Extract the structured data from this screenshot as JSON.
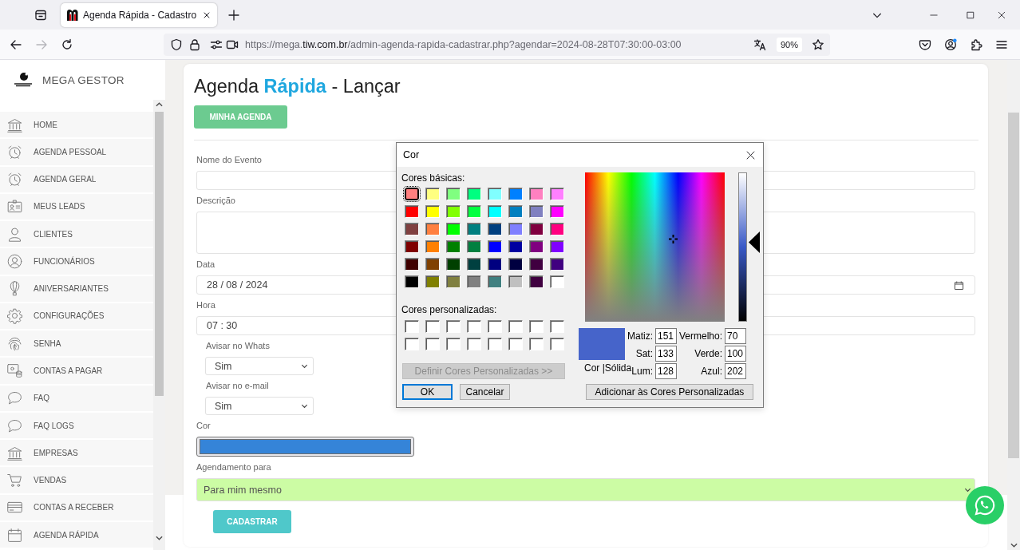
{
  "browser": {
    "tabs": [
      {
        "title": "Agenda Rápida - Cadastro",
        "selected": true
      }
    ],
    "nav_buttons": [
      {
        "kind": "back",
        "disabled": false
      },
      {
        "kind": "forward",
        "disabled": true
      },
      {
        "kind": "reload",
        "disabled": false
      }
    ],
    "url": {
      "prefix": "https://mega.",
      "domain": "tiw.com.br",
      "path": "/admin-agenda-rapida-cadastrar.php?agendar=2024-08-28T07:30:00-03:00"
    },
    "zoom": "90%"
  },
  "sidebar": {
    "brand": "MEGA GESTOR",
    "items": [
      {
        "label": "HOME",
        "kind": "bank"
      },
      {
        "label": "AGENDA PESSOAL",
        "kind": "alarm"
      },
      {
        "label": "AGENDA GERAL",
        "kind": "alarm"
      },
      {
        "label": "MEUS LEADS",
        "kind": "badge"
      },
      {
        "label": "CLIENTES",
        "kind": "user"
      },
      {
        "label": "FUNCIONÁRIOS",
        "kind": "usercircle"
      },
      {
        "label": "ANIVERSARIANTES",
        "kind": "balloon"
      },
      {
        "label": "CONFIGURAÇÕES",
        "kind": "gear"
      },
      {
        "label": "SENHA",
        "kind": "fingerprint"
      },
      {
        "label": "CONTAS A PAGAR",
        "kind": "bills"
      },
      {
        "label": "FAQ",
        "kind": "chat"
      },
      {
        "label": "FAQ LOGS",
        "kind": "chat"
      },
      {
        "label": "EMPRESAS",
        "kind": "bank"
      },
      {
        "label": "VENDAS",
        "kind": "cart"
      },
      {
        "label": "CONTAS A RECEBER",
        "kind": "card"
      },
      {
        "label": "AGENDA RÁPIDA",
        "kind": "calendar"
      }
    ]
  },
  "page": {
    "title": "Agenda **Rápida** - Lançar",
    "agenda_button": "MINHA AGENDA",
    "fields": [
      {
        "kind": "text",
        "label": "Nome do Evento"
      },
      {
        "kind": "textarea",
        "label": "Descrição"
      },
      {
        "kind": "date",
        "label": "Data",
        "value": "28 / 08 / 2024"
      },
      {
        "kind": "time",
        "label": "Hora",
        "value": "07 : 30"
      },
      {
        "kind": "short-select",
        "label": "Avisar no Whats",
        "value": "Sim"
      },
      {
        "kind": "short-select",
        "label": "Avisar no e-mail",
        "value": "Sim"
      },
      {
        "kind": "color",
        "label": "Cor",
        "color": "#3584d8"
      },
      {
        "kind": "wide-select",
        "label": "Agendamento para",
        "value": "Para mim mesmo"
      }
    ],
    "submit_button": "CADASTRAR"
  },
  "color_dialog": {
    "title": "Cor",
    "basic_label": "Cores básicas:",
    "basic_colors": [
      {
        "color": "#ff8080",
        "selected": true
      },
      {
        "color": "#ffff80",
        "selected": false
      },
      {
        "color": "#80ff80",
        "selected": false
      },
      {
        "color": "#00ff80",
        "selected": false
      },
      {
        "color": "#80ffff",
        "selected": false
      },
      {
        "color": "#0080ff",
        "selected": false
      },
      {
        "color": "#ff80c0",
        "selected": false
      },
      {
        "color": "#ff80ff",
        "selected": false
      },
      {
        "color": "#ff0000",
        "selected": false
      },
      {
        "color": "#ffff00",
        "selected": false
      },
      {
        "color": "#80ff00",
        "selected": false
      },
      {
        "color": "#00ff40",
        "selected": false
      },
      {
        "color": "#00ffff",
        "selected": false
      },
      {
        "color": "#0080c0",
        "selected": false
      },
      {
        "color": "#8080c0",
        "selected": false
      },
      {
        "color": "#ff00ff",
        "selected": false
      },
      {
        "color": "#804040",
        "selected": false
      },
      {
        "color": "#ff8040",
        "selected": false
      },
      {
        "color": "#00ff00",
        "selected": false
      },
      {
        "color": "#008080",
        "selected": false
      },
      {
        "color": "#004080",
        "selected": false
      },
      {
        "color": "#8080ff",
        "selected": false
      },
      {
        "color": "#800040",
        "selected": false
      },
      {
        "color": "#ff0080",
        "selected": false
      },
      {
        "color": "#800000",
        "selected": false
      },
      {
        "color": "#ff8000",
        "selected": false
      },
      {
        "color": "#008000",
        "selected": false
      },
      {
        "color": "#008040",
        "selected": false
      },
      {
        "color": "#0000ff",
        "selected": false
      },
      {
        "color": "#0000a0",
        "selected": false
      },
      {
        "color": "#800080",
        "selected": false
      },
      {
        "color": "#8000ff",
        "selected": false
      },
      {
        "color": "#400000",
        "selected": false
      },
      {
        "color": "#804000",
        "selected": false
      },
      {
        "color": "#004000",
        "selected": false
      },
      {
        "color": "#004040",
        "selected": false
      },
      {
        "color": "#000080",
        "selected": false
      },
      {
        "color": "#000040",
        "selected": false
      },
      {
        "color": "#400040",
        "selected": false
      },
      {
        "color": "#400080",
        "selected": false
      },
      {
        "color": "#000000",
        "selected": false
      },
      {
        "color": "#808000",
        "selected": false
      },
      {
        "color": "#808040",
        "selected": false
      },
      {
        "color": "#808080",
        "selected": false
      },
      {
        "color": "#408080",
        "selected": false
      },
      {
        "color": "#c0c0c0",
        "selected": false
      },
      {
        "color": "#400040",
        "selected": false
      },
      {
        "color": "#ffffff",
        "selected": false
      }
    ],
    "custom_label": "Cores personalizadas:",
    "custom_colors": [
      {
        "color": "#ffffff",
        "selected": false
      },
      {
        "color": "#ffffff",
        "selected": false
      },
      {
        "color": "#ffffff",
        "selected": false
      },
      {
        "color": "#ffffff",
        "selected": false
      },
      {
        "color": "#ffffff",
        "selected": false
      },
      {
        "color": "#ffffff",
        "selected": false
      },
      {
        "color": "#ffffff",
        "selected": false
      },
      {
        "color": "#ffffff",
        "selected": false
      },
      {
        "color": "#ffffff",
        "selected": false
      },
      {
        "color": "#ffffff",
        "selected": false
      },
      {
        "color": "#ffffff",
        "selected": false
      },
      {
        "color": "#ffffff",
        "selected": false
      },
      {
        "color": "#ffffff",
        "selected": false
      },
      {
        "color": "#ffffff",
        "selected": false
      },
      {
        "color": "#ffffff",
        "selected": false
      },
      {
        "color": "#ffffff",
        "selected": false
      }
    ],
    "define_button": {
      "label": "Definir Cores Personalizadas >>",
      "disabled": true
    },
    "ok_button": {
      "label": "OK",
      "default": true
    },
    "cancel_button": "Cancelar",
    "luminance": {
      "level": 0.53
    },
    "preview_label": "Cor |Sólida",
    "values": [
      {
        "label": "Matiz:",
        "value": "151"
      },
      {
        "label": "Vermelho:",
        "value": "70"
      },
      {
        "label": "Sat:",
        "value": "133"
      },
      {
        "label": "Verde:",
        "value": "100"
      },
      {
        "label": "Lum:",
        "value": "128"
      },
      {
        "label": "Azul:",
        "value": "202"
      }
    ],
    "add_button": "Adicionar às Cores Personalizadas"
  }
}
